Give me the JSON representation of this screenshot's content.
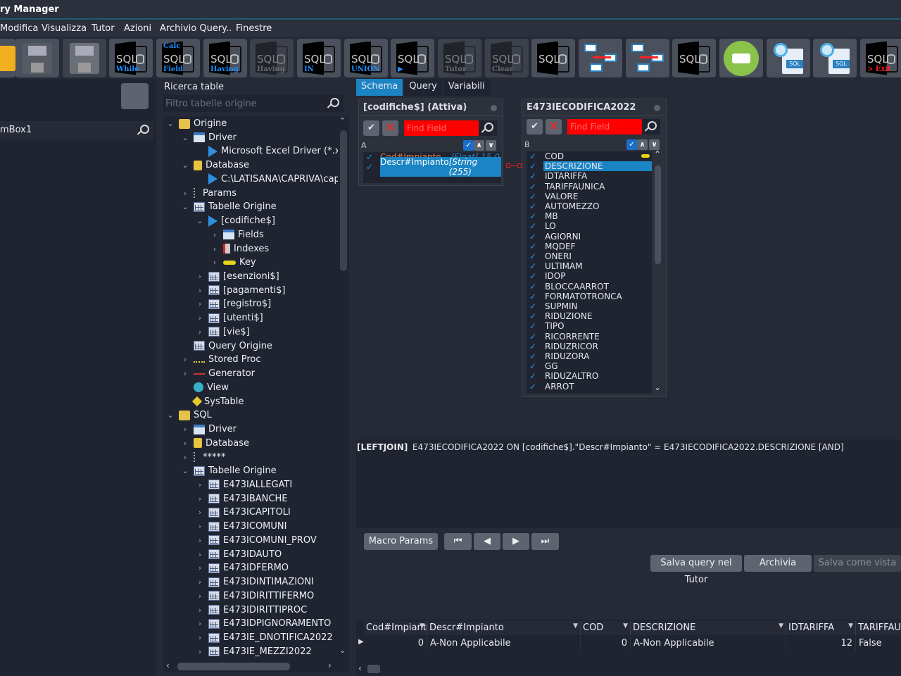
{
  "window": {
    "title": "ry Manager"
  },
  "menu": [
    "Modifica",
    "Visualizza",
    "Tutor",
    "Azioni",
    "Archivio Query..",
    "Finestre"
  ],
  "toolbar": [
    {
      "name": "open-folder",
      "label": ""
    },
    {
      "name": "edit-save",
      "label": ""
    },
    {
      "name": "save",
      "label": "",
      "disabled": true
    },
    {
      "name": "sql-while",
      "label": "While"
    },
    {
      "name": "calc-sql-field",
      "label": "Field",
      "top": "Calc"
    },
    {
      "name": "sql-having",
      "label": "Having"
    },
    {
      "name": "sql-having-disabled",
      "label": "Having",
      "disabled": true
    },
    {
      "name": "sql-in",
      "label": "IN"
    },
    {
      "name": "sql-union",
      "label": "UNION"
    },
    {
      "name": "sql-run",
      "label": "▶"
    },
    {
      "name": "sql-tutor",
      "label": "Tutor",
      "disabled": true
    },
    {
      "name": "sql-clear",
      "label": "Clear",
      "disabled": true
    },
    {
      "name": "sql-script",
      "label": ""
    },
    {
      "name": "add-join",
      "label": ""
    },
    {
      "name": "remove-join",
      "label": ""
    },
    {
      "name": "sql-resize",
      "label": ""
    },
    {
      "name": "print",
      "label": ""
    },
    {
      "name": "search-sql-chart",
      "label": ""
    },
    {
      "name": "search-sql-add",
      "label": ""
    },
    {
      "name": "sql-exit",
      "label": "> Exit"
    }
  ],
  "left": {
    "search_value": "mBox1"
  },
  "ricerca": {
    "label": "Ricerca table",
    "placeholder": "Filtro tabelle origine"
  },
  "tree": [
    {
      "label": "Origine",
      "lvl": 0,
      "arr": "v",
      "ic": "fold"
    },
    {
      "label": "Driver",
      "lvl": 1,
      "arr": "v",
      "ic": "drv"
    },
    {
      "label": "Microsoft Excel Driver (*.xls",
      "lvl": 2,
      "arr": "",
      "ic": "play"
    },
    {
      "label": "Database",
      "lvl": 1,
      "arr": "v",
      "ic": "db"
    },
    {
      "label": "C:\\LATISANA\\CAPRIVA\\cap",
      "lvl": 2,
      "arr": "",
      "ic": "play"
    },
    {
      "label": "Params",
      "lvl": 1,
      "arr": ">",
      "ic": "par"
    },
    {
      "label": "Tabelle Origine",
      "lvl": 1,
      "arr": "v",
      "ic": "tbl"
    },
    {
      "label": "[codifiche$]",
      "lvl": 2,
      "arr": "v",
      "ic": "play"
    },
    {
      "label": "Fields",
      "lvl": 3,
      "arr": ">",
      "ic": "drv"
    },
    {
      "label": "Indexes",
      "lvl": 3,
      "arr": ">",
      "ic": "idx"
    },
    {
      "label": "Key",
      "lvl": 3,
      "arr": ">",
      "ic": "key"
    },
    {
      "label": "[esenzioni$]",
      "lvl": 2,
      "arr": ">",
      "ic": "tbl"
    },
    {
      "label": "[pagamenti$]",
      "lvl": 2,
      "arr": ">",
      "ic": "tbl"
    },
    {
      "label": "[registro$]",
      "lvl": 2,
      "arr": ">",
      "ic": "tbl"
    },
    {
      "label": "[utenti$]",
      "lvl": 2,
      "arr": ">",
      "ic": "tbl"
    },
    {
      "label": "[vie$]",
      "lvl": 2,
      "arr": ">",
      "ic": "tbl"
    },
    {
      "label": "Query Origine",
      "lvl": 1,
      "arr": "",
      "ic": "tbl"
    },
    {
      "label": "Stored Proc",
      "lvl": 1,
      "arr": ">",
      "ic": "sp"
    },
    {
      "label": "Generator",
      "lvl": 1,
      "arr": ">",
      "ic": "gen"
    },
    {
      "label": "View",
      "lvl": 1,
      "arr": "",
      "ic": "view"
    },
    {
      "label": "SysTable",
      "lvl": 1,
      "arr": "",
      "ic": "sys"
    },
    {
      "label": "SQL",
      "lvl": 0,
      "arr": "v",
      "ic": "fold"
    },
    {
      "label": "Driver",
      "lvl": 1,
      "arr": ">",
      "ic": "drv"
    },
    {
      "label": "Database",
      "lvl": 1,
      "arr": ">",
      "ic": "db"
    },
    {
      "label": "*****",
      "lvl": 1,
      "arr": ">",
      "ic": "par"
    },
    {
      "label": "Tabelle Origine",
      "lvl": 1,
      "arr": "v",
      "ic": "tbl"
    },
    {
      "label": "E473IALLEGATI",
      "lvl": 2,
      "arr": ">",
      "ic": "tbl"
    },
    {
      "label": "E473IBANCHE",
      "lvl": 2,
      "arr": ">",
      "ic": "tbl"
    },
    {
      "label": "E473ICAPITOLI",
      "lvl": 2,
      "arr": ">",
      "ic": "tbl"
    },
    {
      "label": "E473ICOMUNI",
      "lvl": 2,
      "arr": ">",
      "ic": "tbl"
    },
    {
      "label": "E473ICOMUNI_PROV",
      "lvl": 2,
      "arr": ">",
      "ic": "tbl"
    },
    {
      "label": "E473IDAUTO",
      "lvl": 2,
      "arr": ">",
      "ic": "tbl"
    },
    {
      "label": "E473IDFERMO",
      "lvl": 2,
      "arr": ">",
      "ic": "tbl"
    },
    {
      "label": "E473IDINTIMAZIONI",
      "lvl": 2,
      "arr": ">",
      "ic": "tbl"
    },
    {
      "label": "E473IDIRITTIFERMO",
      "lvl": 2,
      "arr": ">",
      "ic": "tbl"
    },
    {
      "label": "E473IDIRITTIPROC",
      "lvl": 2,
      "arr": ">",
      "ic": "tbl"
    },
    {
      "label": "E473IDPIGNORAMENTO",
      "lvl": 2,
      "arr": ">",
      "ic": "tbl"
    },
    {
      "label": "E473IE_DNOTIFICA2022",
      "lvl": 2,
      "arr": ">",
      "ic": "tbl"
    },
    {
      "label": "E473IE_MEZZI2022",
      "lvl": 2,
      "arr": ">",
      "ic": "tbl"
    }
  ],
  "tabs": [
    {
      "label": "Schema",
      "active": true
    },
    {
      "label": "Query"
    },
    {
      "label": "Variabili"
    }
  ],
  "tableA": {
    "title": "[codifiche$] (Attiva)",
    "alias": "A",
    "find_placeholder": "Find Field",
    "fields": [
      {
        "name": "Cod#Impianto",
        "type": "[Float] 15,0",
        "checked": true,
        "selected": false
      },
      {
        "name": "Descr#Impianto",
        "type": "[String (255)",
        "checked": true,
        "selected": true
      }
    ]
  },
  "tableB": {
    "title": "E473IECODIFICA2022",
    "alias": "B",
    "find_placeholder": "Find Field",
    "fields": [
      "COD",
      "DESCRIZIONE",
      "IDTARIFFA",
      "TARIFFAUNICA",
      "VALORE",
      "AUTOMEZZO",
      "MB",
      "LO",
      "AGIORNI",
      "MQDEF",
      "ONERI",
      "ULTIMAM",
      "IDOP",
      "BLOCCAARROT",
      "FORMATOTRONCA",
      "SUPMIN",
      "RIDUZIONE",
      "TIPO",
      "RICORRENTE",
      "RIDUZRICOR",
      "RIDUZORA",
      "GG",
      "RIDUZALTRO",
      "ARROT"
    ],
    "selected": "DESCRIZIONE",
    "key_field": "COD"
  },
  "join": {
    "keyword": "[LEFTJOIN]",
    "text": "E473IECODIFICA2022 ON [codifiche$].\"Descr#Impianto\" = E473IECODIFICA2022.DESCRIZIONE [AND]"
  },
  "buttons": {
    "macro": "Macro Params",
    "first": "⏮",
    "prev": "◀",
    "next": "▶",
    "last": "⏭",
    "salva_tutor": "Salva query nel Tutor",
    "archivia": "Archivia",
    "salva_vista": "Salva come vista"
  },
  "grid": {
    "columns": [
      "Cod#Impianto",
      "Descr#Impianto",
      "COD",
      "DESCRIZIONE",
      "IDTARIFFA",
      "TARIFFAUNICA"
    ],
    "rows": [
      [
        "0",
        "A-Non Applicabile",
        "0",
        "A-Non Applicabile",
        "12",
        "False"
      ]
    ]
  }
}
